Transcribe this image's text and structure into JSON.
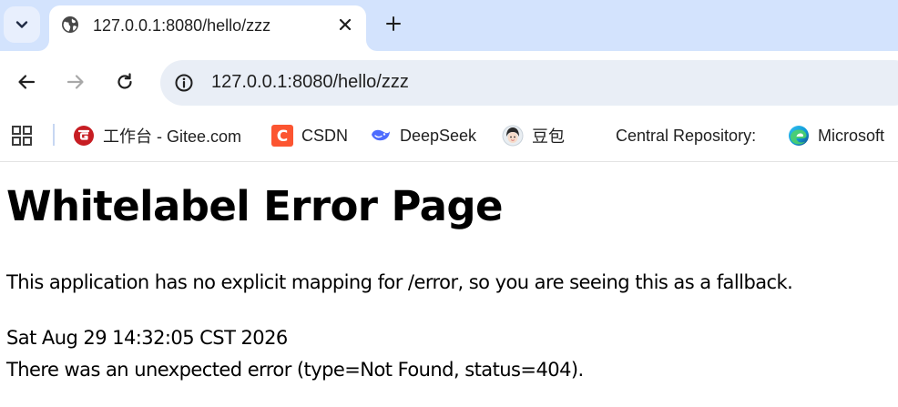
{
  "browser": {
    "tab": {
      "title": "127.0.0.1:8080/hello/zzz",
      "favicon": "globe-icon"
    },
    "toolbar": {
      "back_icon": "arrow-left-icon",
      "forward_icon": "arrow-right-icon",
      "reload_icon": "reload-icon",
      "address": "127.0.0.1:8080/hello/zzz",
      "site_info_icon": "info-icon"
    },
    "bookmarks": [
      {
        "label": "工作台 - Gitee.com",
        "icon": "gitee-icon",
        "color": "#c71d23"
      },
      {
        "label": "CSDN",
        "icon": "csdn-icon",
        "color": "#fc5531"
      },
      {
        "label": "DeepSeek",
        "icon": "deepseek-icon",
        "color": "#4d6bfe"
      },
      {
        "label": "豆包",
        "icon": "doubao-avatar-icon"
      },
      {
        "label": "Central Repository:",
        "icon": ""
      },
      {
        "label": "Microsoft",
        "icon": "edge-icon",
        "color": "#0f9bd7"
      }
    ],
    "colors": {
      "tabstrip": "#d3e3fd",
      "omnibox": "#e9eef6"
    }
  },
  "page": {
    "title": "Whitelabel Error Page",
    "message": "This application has no explicit mapping for /error, so you are seeing this as a fallback.",
    "timestamp": "Sat Aug 29 14:32:05 CST 2026",
    "error": "There was an unexpected error (type=Not Found, status=404)."
  }
}
